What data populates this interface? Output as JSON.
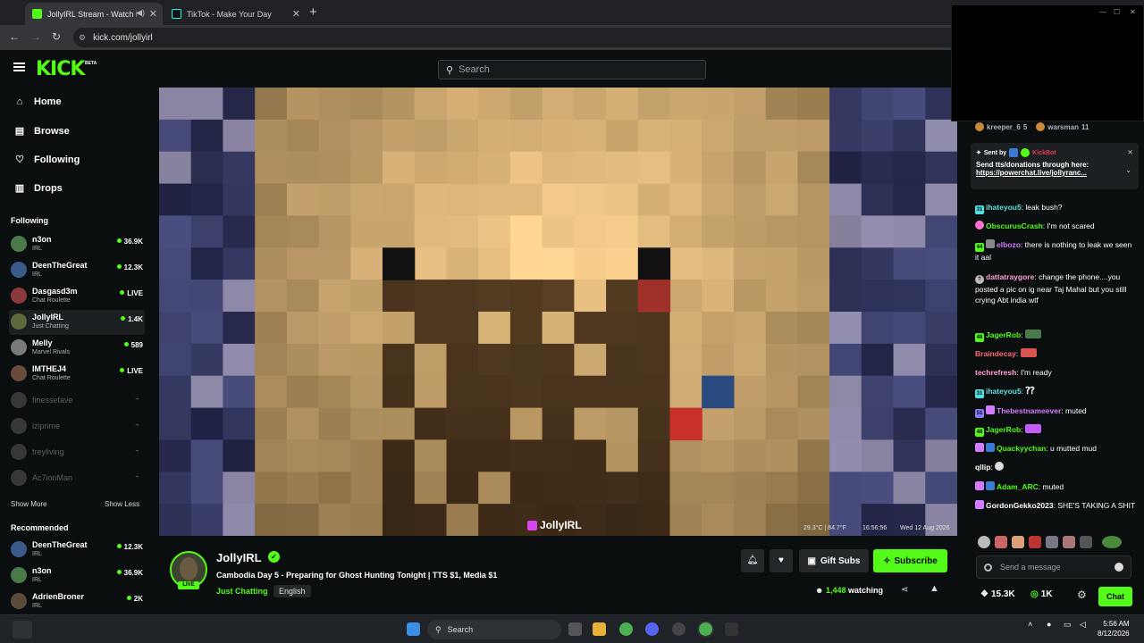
{
  "browser": {
    "tabs": [
      {
        "title": "JollyIRL Stream - Watch Live",
        "active": true
      },
      {
        "title": "TikTok - Make Your Day",
        "active": false
      }
    ],
    "url": "kick.com/jollyirl"
  },
  "header": {
    "logo": "KICK",
    "logo_badge": "BETA",
    "search_placeholder": "Search"
  },
  "sidebar": {
    "nav": [
      {
        "label": "Home",
        "icon": "home-icon"
      },
      {
        "label": "Browse",
        "icon": "browse-icon"
      },
      {
        "label": "Following",
        "icon": "heart-icon"
      },
      {
        "label": "Drops",
        "icon": "drops-icon"
      }
    ],
    "following_title": "Following",
    "following": [
      {
        "name": "n3on",
        "category": "IRL",
        "viewers": "36.9K",
        "color": "#4a7a4a"
      },
      {
        "name": "DeenTheGreat",
        "category": "IRL",
        "viewers": "12.3K",
        "color": "#3a5a8a"
      },
      {
        "name": "Dasgasd3m",
        "category": "Chat Roulette",
        "viewers": "LIVE",
        "color": "#8a3a3a"
      },
      {
        "name": "JollyIRL",
        "category": "Just Chatting",
        "viewers": "1.4K",
        "color": "#5a6a3a"
      },
      {
        "name": "Melly",
        "category": "Marvel Rivals",
        "viewers": "589",
        "color": "#7a7a7a"
      },
      {
        "name": "IMTHEJ4",
        "category": "Chat Roulette",
        "viewers": "LIVE",
        "color": "#6a4a3a"
      }
    ],
    "offline": [
      {
        "name": "finessefave"
      },
      {
        "name": "lziprime"
      },
      {
        "name": "treyliving"
      },
      {
        "name": "Ac7ionMan"
      }
    ],
    "show_more": "Show More",
    "show_less": "Show Less",
    "recommended_title": "Recommended",
    "recommended": [
      {
        "name": "DeenTheGreat",
        "category": "IRL",
        "viewers": "12.3K",
        "color": "#3a5a8a"
      },
      {
        "name": "n3on",
        "category": "IRL",
        "viewers": "36.9K",
        "color": "#4a7a4a"
      },
      {
        "name": "AdrienBroner",
        "category": "IRL",
        "viewers": "2K",
        "color": "#5a4a3a"
      }
    ]
  },
  "video": {
    "osd_temp": "29.3°C | 84.7°F",
    "osd_time": "16:56:56",
    "osd_date": "Wed 12 Aug 2026",
    "watermark": "JollyIRL"
  },
  "stream": {
    "channel": "JollyIRL",
    "live_label": "LIVE",
    "title": "Cambodia Day 5 - Preparing for Ghost Hunting Tonight | TTS $1, Media $1",
    "category": "Just Chatting",
    "language": "English",
    "gift_label": "Gift Subs",
    "subscribe_label": "Subscribe",
    "viewers": "1,448",
    "viewers_suffix": "watching"
  },
  "chat": {
    "gifters": [
      {
        "name": "kreeper_6",
        "count": "5"
      },
      {
        "name": "warsman",
        "count": "11"
      }
    ],
    "pinned": {
      "sent_by": "Sent by",
      "sender": "KickBot",
      "message": "Send tts/donations through here:",
      "link": "https://powerchat.live/jollyranc..."
    },
    "messages": [
      {
        "user": "ihateyou5",
        "color": "#5ee0e0",
        "text": "leak bush?"
      },
      {
        "user": "ObscurusCrash",
        "color": "#53fc18",
        "text": "I'm not scared"
      },
      {
        "user": "elbozo",
        "color": "#d37cff",
        "text": "there is nothing to leak we seen it aal"
      },
      {
        "user": "dattatraygore",
        "color": "#ff9fd6",
        "text": "change the phone....you posted a pic on ig near Taj Mahal but you still crying Abt india wtf"
      },
      {
        "user": "JagerRob",
        "color": "#53fc18",
        "text": ""
      },
      {
        "user": "Braindecay",
        "color": "#ff6b6b",
        "text": ""
      },
      {
        "user": "techrefresh",
        "color": "#ff9fd6",
        "text": "I'm ready"
      },
      {
        "user": "ihateyou5",
        "color": "#5ee0e0",
        "text": "⁇"
      },
      {
        "user": "Thebestnameever",
        "color": "#d37cff",
        "text": "muted"
      },
      {
        "user": "JagerRob",
        "color": "#53fc18",
        "text": ""
      },
      {
        "user": "Quackyychan",
        "color": "#53fc18",
        "text": "u mutted mud"
      },
      {
        "user": "qllip",
        "color": "#ffffff",
        "text": ""
      },
      {
        "user": "Adam_ARC",
        "color": "#53fc18",
        "text": "muted"
      },
      {
        "user": "GordonGekko2023",
        "color": "#ffffff",
        "text": "SHE'S TAKING A SHIT"
      }
    ],
    "send_placeholder": "Send a message",
    "followers": "15.3K",
    "kicks": "1K",
    "chat_button": "Chat"
  },
  "taskbar": {
    "search": "Search",
    "time": "5:56 AM",
    "date": "8/12/2026"
  }
}
